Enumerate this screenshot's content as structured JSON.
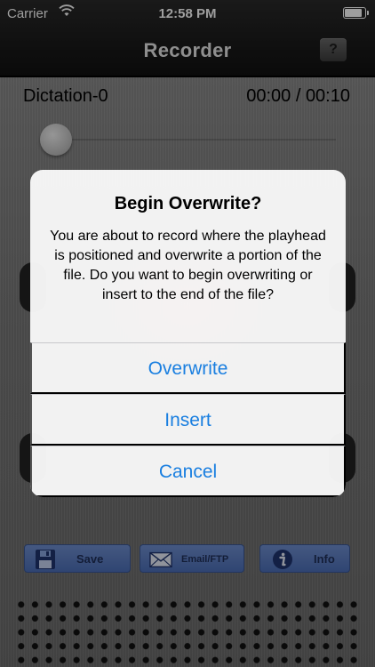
{
  "status_bar": {
    "carrier": "Carrier",
    "time": "12:58 PM"
  },
  "nav": {
    "title": "Recorder",
    "help_label": "?"
  },
  "recording": {
    "name": "Dictation-0",
    "time": "00:00 / 00:10",
    "position_fraction": 0.0
  },
  "toolbar": {
    "save_label": "Save",
    "email_label": "Email/FTP",
    "info_label": "Info"
  },
  "alert": {
    "title": "Begin Overwrite?",
    "message": "You are about to record where the playhead is positioned and overwrite a portion of the file. Do you want to begin overwriting or insert to the end of the file?",
    "buttons": [
      "Overwrite",
      "Insert",
      "Cancel"
    ]
  },
  "colors": {
    "alert_button": "#1a7fe0",
    "toolbar_button": "#5a7cc2",
    "nav_bar": "#1e1e1e"
  },
  "icons": {
    "wifi": "wifi-icon",
    "battery": "battery-icon",
    "save": "floppy-disk-icon",
    "email": "envelope-icon",
    "info": "info-icon"
  }
}
